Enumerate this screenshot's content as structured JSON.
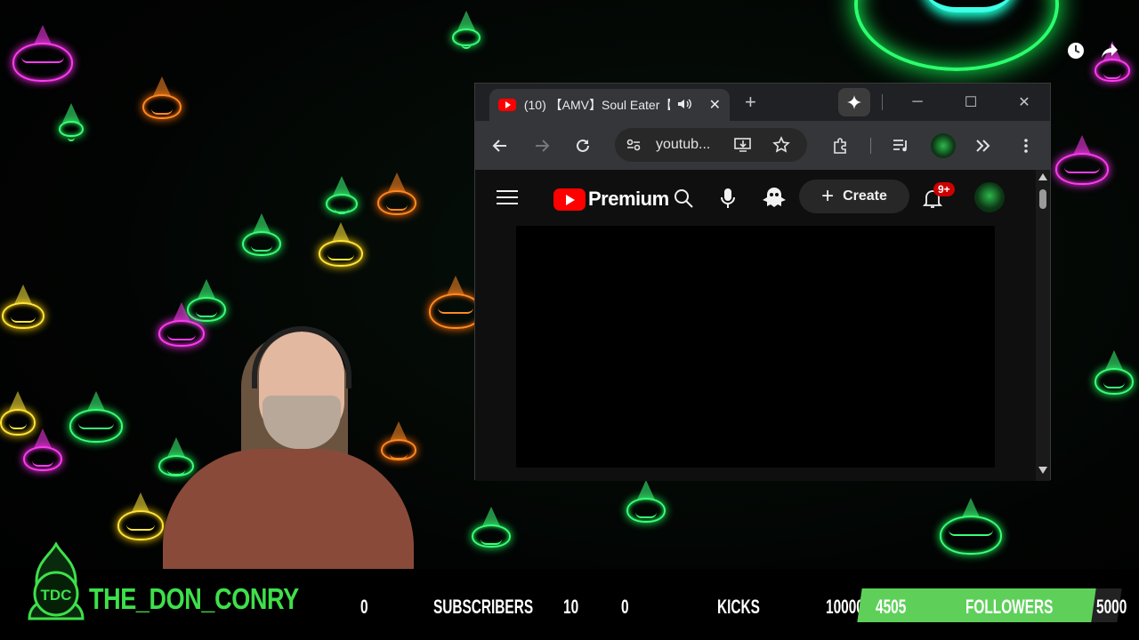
{
  "browser": {
    "tab_title": "(10) 【AMV】Soul Eater【",
    "new_tab_symbol": "+",
    "address": "youtub...",
    "window_controls": {
      "minimize": "─",
      "maximize": "☐",
      "close": "✕"
    }
  },
  "youtube": {
    "logo_text": "Premium",
    "create_label": "Create",
    "notification_count": "9+"
  },
  "stream": {
    "channel_name": "THE_DON_CONRY",
    "subscribers": {
      "current": "0",
      "label": "SUBSCRIBERS",
      "goal": "10"
    },
    "kicks": {
      "current": "0",
      "label": "KICKS",
      "goal": "10000"
    },
    "followers": {
      "current": "4505",
      "label": "FOLLOWERS",
      "goal": "5000",
      "progress": 0.901
    }
  },
  "icons": {
    "overlay": [
      "clock-icon",
      "share-icon"
    ],
    "browser": [
      "youtube-favicon",
      "speaker-icon",
      "tab-close-icon",
      "new-tab-icon",
      "gemini-icon",
      "back-icon",
      "forward-icon",
      "reload-icon",
      "site-info-icon",
      "install-icon",
      "bookmark-star-icon",
      "extensions-icon",
      "media-queue-icon",
      "profile-avatar",
      "more-tools-icon",
      "kebab-menu-icon"
    ],
    "youtube": [
      "hamburger-menu-icon",
      "search-icon",
      "mic-icon",
      "ghost-icon",
      "bell-icon"
    ]
  },
  "colors": {
    "channel_green": "#3ee04a",
    "youtube_red": "#ff0000",
    "follower_fill": "#5ed05a"
  }
}
